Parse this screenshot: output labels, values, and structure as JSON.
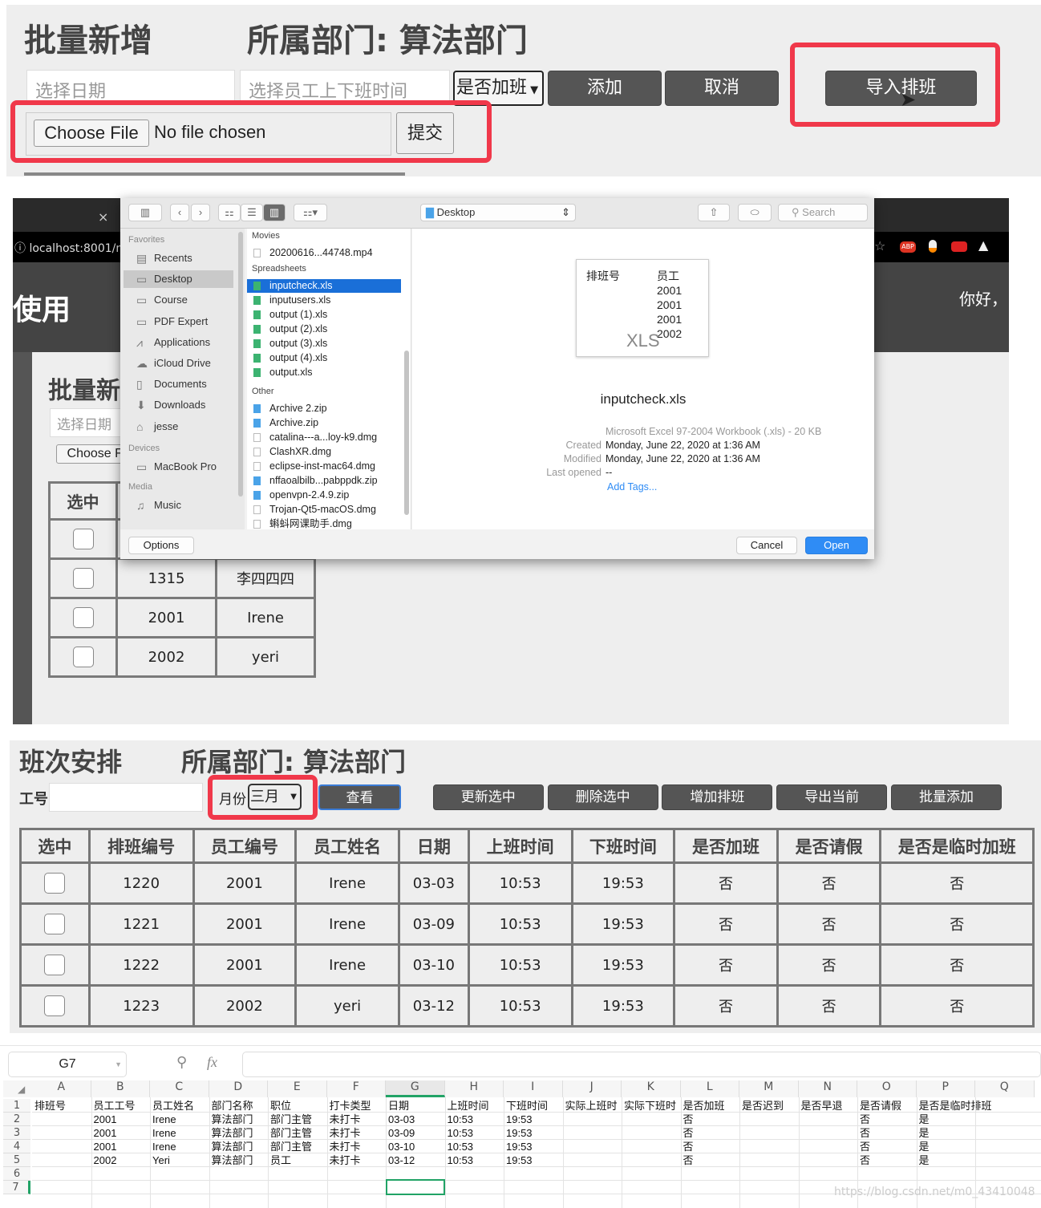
{
  "top": {
    "title": "批量新增",
    "dept": "所属部门: 算法部门",
    "date_ph": "选择日期",
    "time_ph": "选择员工上下班时间",
    "overtime_select": "是否加班",
    "add": "添加",
    "cancel": "取消",
    "import": "导入排班",
    "choose_file": "Choose File",
    "no_file": "No file chosen",
    "submit": "提交"
  },
  "browser": {
    "url": "localhost:8001/m",
    "header_text": "使用",
    "greeting": "你好，",
    "title": "批量新",
    "date_ph": "选择日期",
    "choose_file": "Choose Fi",
    "col_select": "选中",
    "rows": [
      {
        "id": "",
        "name": ""
      },
      {
        "id": "1315",
        "name": "李四四四"
      },
      {
        "id": "2001",
        "name": "Irene"
      },
      {
        "id": "2002",
        "name": "yeri"
      }
    ],
    "extensions": [
      "star-icon",
      "adblock-icon",
      "extension-icon",
      "youtube-icon",
      "mountain-icon"
    ]
  },
  "dialog": {
    "location": "Desktop",
    "search_ph": "Search",
    "sidebar": {
      "favorites": "Favorites",
      "items": [
        "Recents",
        "Desktop",
        "Course",
        "PDF Expert",
        "Applications",
        "iCloud Drive",
        "Documents",
        "Downloads",
        "jesse"
      ],
      "devices": "Devices",
      "device_items": [
        "MacBook Pro"
      ],
      "media": "Media",
      "media_items": [
        "Music"
      ]
    },
    "groups": [
      {
        "title": "Movies",
        "files": [
          "20200616...44748.mp4"
        ]
      },
      {
        "title": "Spreadsheets",
        "files": [
          "inputcheck.xls",
          "inputusers.xls",
          "output (1).xls",
          "output (2).xls",
          "output (3).xls",
          "output (4).xls",
          "output.xls"
        ]
      },
      {
        "title": "Other",
        "files": [
          "Archive 2.zip",
          "Archive.zip",
          "catalina---a...loy-k9.dmg",
          "ClashXR.dmg",
          "eclipse-inst-mac64.dmg",
          "nffaoalbilb...pabppdk.zip",
          "openvpn-2.4.9.zip",
          "Trojan-Qt5-macOS.dmg",
          "蝌蚪网课助手.dmg"
        ]
      }
    ],
    "selected_file": "inputcheck.xls",
    "preview": {
      "thumb_header": [
        "排班号",
        "员工"
      ],
      "thumb_values": [
        "2001",
        "2001",
        "2001",
        "2002"
      ],
      "thumb_label": "XLS",
      "name": "inputcheck.xls",
      "kind": "Microsoft Excel 97-2004 Workbook (.xls) - 20 KB",
      "created_label": "Created",
      "created": "Monday, June 22, 2020 at 1:36 AM",
      "modified_label": "Modified",
      "modified": "Monday, June 22, 2020 at 1:36 AM",
      "opened_label": "Last opened",
      "opened": "--",
      "tags": "Add Tags..."
    },
    "options": "Options",
    "cancel": "Cancel",
    "open": "Open"
  },
  "schedule": {
    "title": "班次安排",
    "dept": "所属部门: 算法部门",
    "emp_label": "工号",
    "emp_value": "",
    "month_label": "月份",
    "month": "三月",
    "buttons": [
      "查看",
      "更新选中",
      "删除选中",
      "增加排班",
      "导出当前",
      "批量添加"
    ],
    "columns": [
      "选中",
      "排班编号",
      "员工编号",
      "员工姓名",
      "日期",
      "上班时间",
      "下班时间",
      "是否加班",
      "是否请假",
      "是否是临时加班"
    ],
    "rows": [
      [
        "1220",
        "2001",
        "Irene",
        "03-03",
        "10:53",
        "19:53",
        "否",
        "否",
        "否"
      ],
      [
        "1221",
        "2001",
        "Irene",
        "03-09",
        "10:53",
        "19:53",
        "否",
        "否",
        "否"
      ],
      [
        "1222",
        "2001",
        "Irene",
        "03-10",
        "10:53",
        "19:53",
        "否",
        "否",
        "否"
      ],
      [
        "1223",
        "2002",
        "yeri",
        "03-12",
        "10:53",
        "19:53",
        "否",
        "否",
        "否"
      ]
    ]
  },
  "sheet": {
    "cell_ref": "G7",
    "fx": "fx",
    "formula": "",
    "col_letters": [
      "A",
      "B",
      "C",
      "D",
      "E",
      "F",
      "G",
      "H",
      "I",
      "J",
      "K",
      "L",
      "M",
      "N",
      "O",
      "P",
      "Q"
    ],
    "rows": [
      [
        "排班号",
        "员工工号",
        "员工姓名",
        "部门名称",
        "职位",
        "打卡类型",
        "日期",
        "上班时间",
        "下班时间",
        "实际上班时",
        "实际下班时",
        "是否加班",
        "是否迟到",
        "是否早退",
        "是否请假",
        "是否是临时排班",
        ""
      ],
      [
        "",
        "2001",
        "Irene",
        "算法部门",
        "部门主管",
        "未打卡",
        "03-03",
        "10:53",
        "19:53",
        "",
        "",
        "否",
        "",
        "",
        "否",
        "是",
        ""
      ],
      [
        "",
        "2001",
        "Irene",
        "算法部门",
        "部门主管",
        "未打卡",
        "03-09",
        "10:53",
        "19:53",
        "",
        "",
        "否",
        "",
        "",
        "否",
        "是",
        ""
      ],
      [
        "",
        "2001",
        "Irene",
        "算法部门",
        "部门主管",
        "未打卡",
        "03-10",
        "10:53",
        "19:53",
        "",
        "",
        "否",
        "",
        "",
        "否",
        "是",
        ""
      ],
      [
        "",
        "2002",
        "Yeri",
        "算法部门",
        "员工",
        "未打卡",
        "03-12",
        "10:53",
        "19:53",
        "",
        "",
        "否",
        "",
        "",
        "否",
        "是",
        ""
      ],
      [
        "",
        "",
        "",
        "",
        "",
        "",
        "",
        "",
        "",
        "",
        "",
        "",
        "",
        "",
        "",
        "",
        ""
      ],
      [
        "",
        "",
        "",
        "",
        "",
        "",
        "",
        "",
        "",
        "",
        "",
        "",
        "",
        "",
        "",
        "",
        ""
      ]
    ],
    "watermark": "https://blog.csdn.net/m0_43410048"
  },
  "colors": {
    "accent_red": "#f0384a",
    "dark_button": "#555555",
    "mac_blue": "#1a6fd8",
    "sheet_green": "#21a366"
  }
}
